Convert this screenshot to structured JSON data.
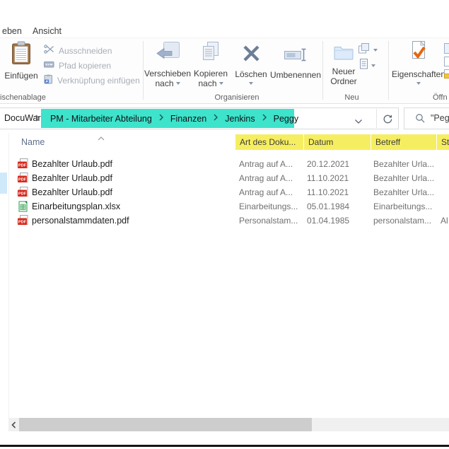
{
  "window": {
    "tabs": [
      {
        "label": "eben"
      },
      {
        "label": "Ansicht"
      }
    ]
  },
  "ribbon": {
    "clipboard_group": {
      "label": "ischenablage",
      "paste": "Einfügen",
      "cut": "Ausschneiden",
      "copy_path": "Pfad kopieren",
      "paste_shortcut": "Verknüpfung einfügen"
    },
    "organize_group": {
      "label": "Organisieren",
      "move_to_line1": "Verschieben",
      "move_to_line2": "nach",
      "copy_to_line1": "Kopieren",
      "copy_to_line2": "nach",
      "delete": "Löschen",
      "rename": "Umbenennen"
    },
    "new_group": {
      "label": "Neu",
      "new_folder_line1": "Neuer",
      "new_folder_line2": "Ordner"
    },
    "open_group": {
      "label": "Öffn",
      "properties": "Eigenschaften"
    }
  },
  "address_bar": {
    "root_segment": "DocuWare",
    "segments": [
      "PM - Mitarbeiter Abteilung",
      "Finanzen",
      "Jenkins",
      "Peggy"
    ],
    "highlight_color": "#3DE3CB"
  },
  "search": {
    "text": "\"Peg"
  },
  "file_list": {
    "header_highlight_color": "#F6EE61",
    "columns": [
      "Name",
      "Art des Doku...",
      "Datum",
      "Betreff",
      "St"
    ],
    "rows": [
      {
        "type": "pdf",
        "name": "Bezahlter Urlaub.pdf",
        "doc_type": "Antrag auf A...",
        "date": "20.12.2021",
        "subject": "Bezahlter Urla...",
        "extra": ""
      },
      {
        "type": "pdf",
        "name": "Bezahlter Urlaub.pdf",
        "doc_type": "Antrag auf A...",
        "date": "11.10.2021",
        "subject": "Bezahlter Urla...",
        "extra": ""
      },
      {
        "type": "pdf",
        "name": "Bezahlter Urlaub.pdf",
        "doc_type": "Antrag auf A...",
        "date": "11.10.2021",
        "subject": "Bezahlter Urla...",
        "extra": ""
      },
      {
        "type": "xlsx",
        "name": "Einarbeitungsplan.xlsx",
        "doc_type": "Einarbeitungs...",
        "date": "05.01.1984",
        "subject": "Einarbeitungs...",
        "extra": ""
      },
      {
        "type": "pdf",
        "name": "personalstammdaten.pdf",
        "doc_type": "Personalstam...",
        "date": "01.04.1985",
        "subject": "personalstam...",
        "extra": "Al"
      }
    ]
  },
  "icons": {
    "pdf_badge": "PDF"
  }
}
